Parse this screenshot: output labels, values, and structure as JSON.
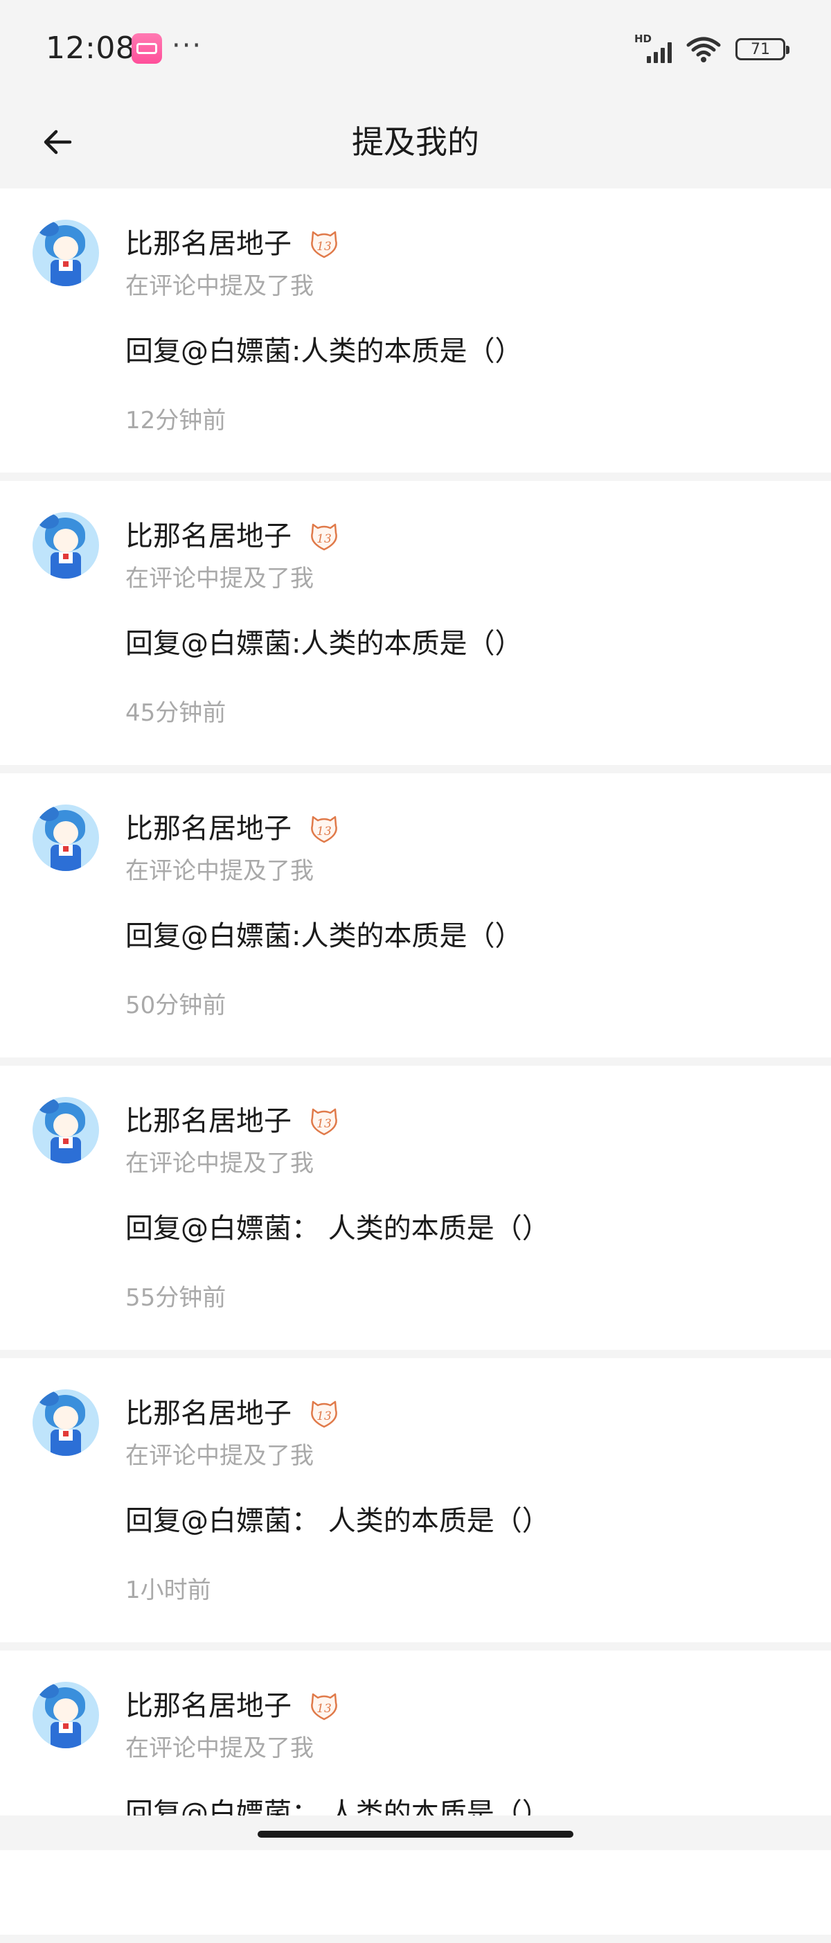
{
  "status_bar": {
    "time": "12:08",
    "more": "···",
    "network": "HD",
    "battery": "71"
  },
  "header": {
    "title": "提及我的"
  },
  "notifications": [
    {
      "user": "比那名居地子",
      "type_label": "在评论中提及了我",
      "comment": "回复@白嫖菌:人类的本质是（）",
      "time_ago": "12分钟前"
    },
    {
      "user": "比那名居地子",
      "type_label": "在评论中提及了我",
      "comment": "回复@白嫖菌:人类的本质是（）",
      "time_ago": "45分钟前"
    },
    {
      "user": "比那名居地子",
      "type_label": "在评论中提及了我",
      "comment": "回复@白嫖菌:人类的本质是（）",
      "time_ago": "50分钟前"
    },
    {
      "user": "比那名居地子",
      "type_label": "在评论中提及了我",
      "comment": "回复@白嫖菌： 人类的本质是（）",
      "time_ago": "55分钟前"
    },
    {
      "user": "比那名居地子",
      "type_label": "在评论中提及了我",
      "comment": "回复@白嫖菌： 人类的本质是（）",
      "time_ago": "1小时前"
    },
    {
      "user": "比那名居地子",
      "type_label": "在评论中提及了我",
      "comment": "回复@白嫖菌： 人类的本质是（）",
      "time_ago": ""
    }
  ],
  "icons": {
    "back": "arrow-left-icon",
    "level_badge": "level-badge-icon",
    "app": "bilibili-app-icon"
  },
  "colors": {
    "background": "#f4f4f4",
    "card": "#ffffff",
    "secondary_text": "#a9a9a9",
    "badge": "#e07a4a"
  }
}
